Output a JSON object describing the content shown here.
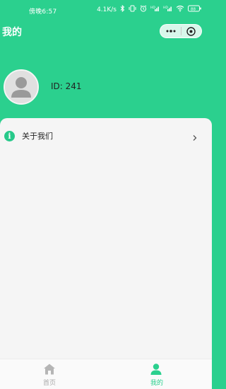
{
  "status_bar": {
    "time": "傍晚6:57",
    "net_speed": "4.1K/s",
    "battery": "88"
  },
  "header": {
    "title": "我的"
  },
  "profile": {
    "id_text": "ID: 241"
  },
  "menu": {
    "items": [
      {
        "label": "关于我们",
        "icon": "info-icon"
      }
    ]
  },
  "tabbar": {
    "tabs": [
      {
        "label": "首页",
        "icon": "home-icon",
        "active": false
      },
      {
        "label": "我的",
        "icon": "user-icon",
        "active": true
      }
    ]
  },
  "colors": {
    "brand": "#2bd08e",
    "panel_bg": "#f5f5f5",
    "tab_inactive": "#aaaaaa"
  }
}
